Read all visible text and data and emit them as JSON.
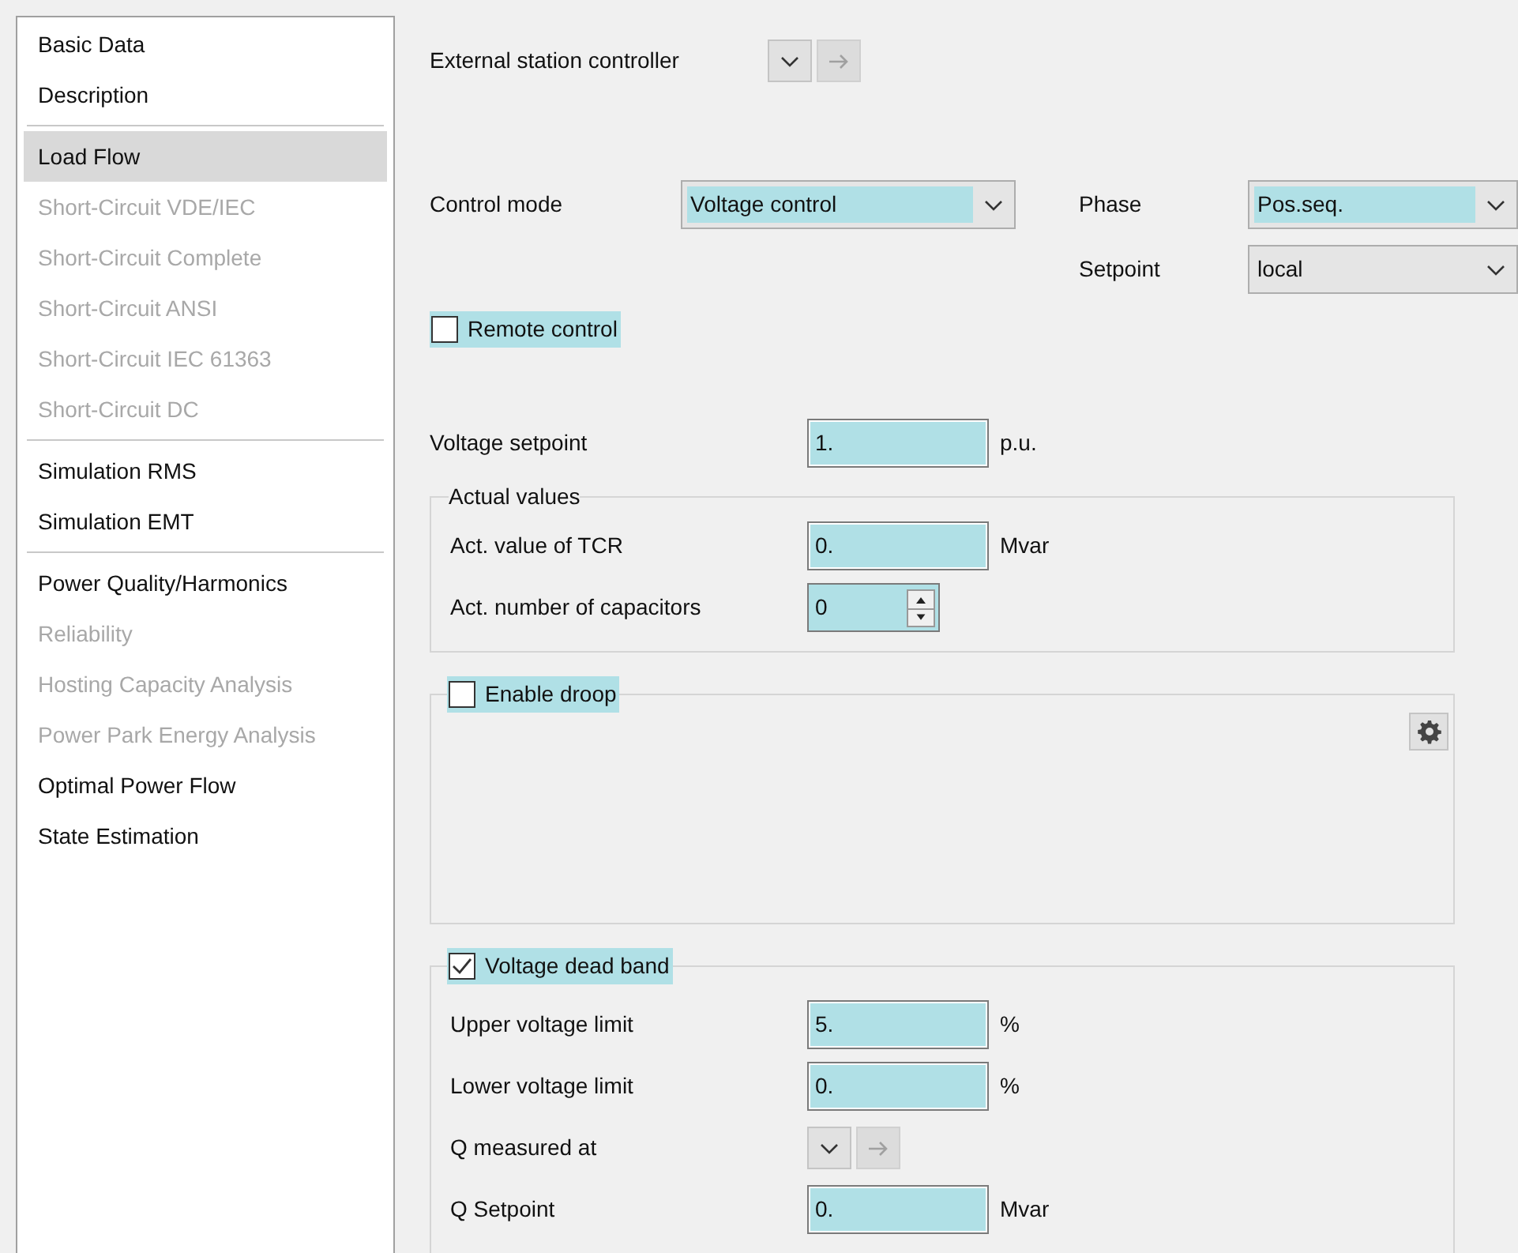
{
  "sidebar": {
    "groups": [
      {
        "items": [
          {
            "label": "Basic Data",
            "selected": false,
            "disabled": false
          },
          {
            "label": "Description",
            "selected": false,
            "disabled": false
          }
        ]
      },
      {
        "items": [
          {
            "label": "Load Flow",
            "selected": true,
            "disabled": false
          },
          {
            "label": "Short-Circuit VDE/IEC",
            "selected": false,
            "disabled": true
          },
          {
            "label": "Short-Circuit Complete",
            "selected": false,
            "disabled": true
          },
          {
            "label": "Short-Circuit ANSI",
            "selected": false,
            "disabled": true
          },
          {
            "label": "Short-Circuit IEC 61363",
            "selected": false,
            "disabled": true
          },
          {
            "label": "Short-Circuit DC",
            "selected": false,
            "disabled": true
          }
        ]
      },
      {
        "items": [
          {
            "label": "Simulation RMS",
            "selected": false,
            "disabled": false
          },
          {
            "label": "Simulation EMT",
            "selected": false,
            "disabled": false
          }
        ]
      },
      {
        "items": [
          {
            "label": "Power Quality/Harmonics",
            "selected": false,
            "disabled": false
          },
          {
            "label": "Reliability",
            "selected": false,
            "disabled": true
          },
          {
            "label": "Hosting Capacity Analysis",
            "selected": false,
            "disabled": true
          },
          {
            "label": "Power Park Energy Analysis",
            "selected": false,
            "disabled": true
          },
          {
            "label": "Optimal Power Flow",
            "selected": false,
            "disabled": false
          },
          {
            "label": "State Estimation",
            "selected": false,
            "disabled": false
          }
        ]
      }
    ]
  },
  "external_station_controller": {
    "label": "External station controller"
  },
  "control_mode": {
    "label": "Control mode",
    "value": "Voltage control"
  },
  "phase": {
    "label": "Phase",
    "value": "Pos.seq."
  },
  "setpoint": {
    "label": "Setpoint",
    "value": "local"
  },
  "remote_control": {
    "label": "Remote control",
    "checked": false
  },
  "voltage_setpoint": {
    "label": "Voltage setpoint",
    "value": "1.",
    "unit": "p.u."
  },
  "actual_values": {
    "title": "Actual values",
    "rows": [
      {
        "kind": "field",
        "label": "Act. value of TCR",
        "value": "0.",
        "unit": "Mvar"
      },
      {
        "kind": "spinner",
        "label": "Act. number of capacitors",
        "value": "0"
      }
    ]
  },
  "enable_droop": {
    "label": "Enable droop",
    "checked": false
  },
  "voltage_dead_band": {
    "label": "Voltage dead band",
    "checked": true,
    "rows": [
      {
        "kind": "field",
        "label": "Upper voltage limit",
        "value": "5.",
        "unit": "%"
      },
      {
        "kind": "field",
        "label": "Lower voltage limit",
        "value": "0.",
        "unit": "%"
      },
      {
        "kind": "selector",
        "label": "Q measured at"
      },
      {
        "kind": "field",
        "label": "Q Setpoint",
        "value": "0.",
        "unit": "Mvar"
      }
    ]
  }
}
